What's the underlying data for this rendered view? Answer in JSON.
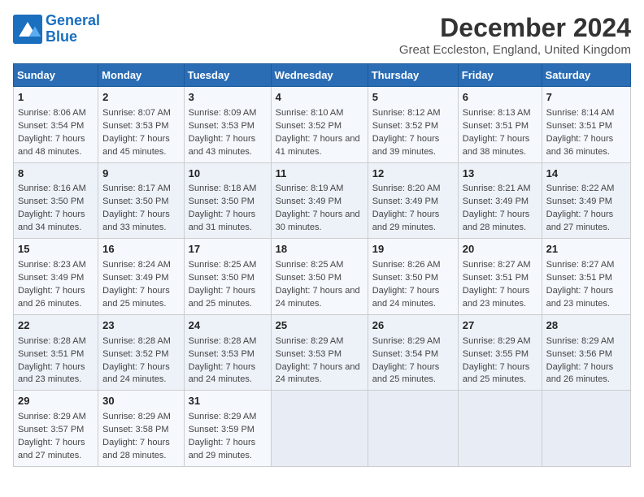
{
  "logo": {
    "line1": "General",
    "line2": "Blue"
  },
  "title": "December 2024",
  "subtitle": "Great Eccleston, England, United Kingdom",
  "days_of_week": [
    "Sunday",
    "Monday",
    "Tuesday",
    "Wednesday",
    "Thursday",
    "Friday",
    "Saturday"
  ],
  "weeks": [
    [
      {
        "day": "1",
        "sunrise": "Sunrise: 8:06 AM",
        "sunset": "Sunset: 3:54 PM",
        "daylight": "Daylight: 7 hours and 48 minutes."
      },
      {
        "day": "2",
        "sunrise": "Sunrise: 8:07 AM",
        "sunset": "Sunset: 3:53 PM",
        "daylight": "Daylight: 7 hours and 45 minutes."
      },
      {
        "day": "3",
        "sunrise": "Sunrise: 8:09 AM",
        "sunset": "Sunset: 3:53 PM",
        "daylight": "Daylight: 7 hours and 43 minutes."
      },
      {
        "day": "4",
        "sunrise": "Sunrise: 8:10 AM",
        "sunset": "Sunset: 3:52 PM",
        "daylight": "Daylight: 7 hours and 41 minutes."
      },
      {
        "day": "5",
        "sunrise": "Sunrise: 8:12 AM",
        "sunset": "Sunset: 3:52 PM",
        "daylight": "Daylight: 7 hours and 39 minutes."
      },
      {
        "day": "6",
        "sunrise": "Sunrise: 8:13 AM",
        "sunset": "Sunset: 3:51 PM",
        "daylight": "Daylight: 7 hours and 38 minutes."
      },
      {
        "day": "7",
        "sunrise": "Sunrise: 8:14 AM",
        "sunset": "Sunset: 3:51 PM",
        "daylight": "Daylight: 7 hours and 36 minutes."
      }
    ],
    [
      {
        "day": "8",
        "sunrise": "Sunrise: 8:16 AM",
        "sunset": "Sunset: 3:50 PM",
        "daylight": "Daylight: 7 hours and 34 minutes."
      },
      {
        "day": "9",
        "sunrise": "Sunrise: 8:17 AM",
        "sunset": "Sunset: 3:50 PM",
        "daylight": "Daylight: 7 hours and 33 minutes."
      },
      {
        "day": "10",
        "sunrise": "Sunrise: 8:18 AM",
        "sunset": "Sunset: 3:50 PM",
        "daylight": "Daylight: 7 hours and 31 minutes."
      },
      {
        "day": "11",
        "sunrise": "Sunrise: 8:19 AM",
        "sunset": "Sunset: 3:49 PM",
        "daylight": "Daylight: 7 hours and 30 minutes."
      },
      {
        "day": "12",
        "sunrise": "Sunrise: 8:20 AM",
        "sunset": "Sunset: 3:49 PM",
        "daylight": "Daylight: 7 hours and 29 minutes."
      },
      {
        "day": "13",
        "sunrise": "Sunrise: 8:21 AM",
        "sunset": "Sunset: 3:49 PM",
        "daylight": "Daylight: 7 hours and 28 minutes."
      },
      {
        "day": "14",
        "sunrise": "Sunrise: 8:22 AM",
        "sunset": "Sunset: 3:49 PM",
        "daylight": "Daylight: 7 hours and 27 minutes."
      }
    ],
    [
      {
        "day": "15",
        "sunrise": "Sunrise: 8:23 AM",
        "sunset": "Sunset: 3:49 PM",
        "daylight": "Daylight: 7 hours and 26 minutes."
      },
      {
        "day": "16",
        "sunrise": "Sunrise: 8:24 AM",
        "sunset": "Sunset: 3:49 PM",
        "daylight": "Daylight: 7 hours and 25 minutes."
      },
      {
        "day": "17",
        "sunrise": "Sunrise: 8:25 AM",
        "sunset": "Sunset: 3:50 PM",
        "daylight": "Daylight: 7 hours and 25 minutes."
      },
      {
        "day": "18",
        "sunrise": "Sunrise: 8:25 AM",
        "sunset": "Sunset: 3:50 PM",
        "daylight": "Daylight: 7 hours and 24 minutes."
      },
      {
        "day": "19",
        "sunrise": "Sunrise: 8:26 AM",
        "sunset": "Sunset: 3:50 PM",
        "daylight": "Daylight: 7 hours and 24 minutes."
      },
      {
        "day": "20",
        "sunrise": "Sunrise: 8:27 AM",
        "sunset": "Sunset: 3:51 PM",
        "daylight": "Daylight: 7 hours and 23 minutes."
      },
      {
        "day": "21",
        "sunrise": "Sunrise: 8:27 AM",
        "sunset": "Sunset: 3:51 PM",
        "daylight": "Daylight: 7 hours and 23 minutes."
      }
    ],
    [
      {
        "day": "22",
        "sunrise": "Sunrise: 8:28 AM",
        "sunset": "Sunset: 3:51 PM",
        "daylight": "Daylight: 7 hours and 23 minutes."
      },
      {
        "day": "23",
        "sunrise": "Sunrise: 8:28 AM",
        "sunset": "Sunset: 3:52 PM",
        "daylight": "Daylight: 7 hours and 24 minutes."
      },
      {
        "day": "24",
        "sunrise": "Sunrise: 8:28 AM",
        "sunset": "Sunset: 3:53 PM",
        "daylight": "Daylight: 7 hours and 24 minutes."
      },
      {
        "day": "25",
        "sunrise": "Sunrise: 8:29 AM",
        "sunset": "Sunset: 3:53 PM",
        "daylight": "Daylight: 7 hours and 24 minutes."
      },
      {
        "day": "26",
        "sunrise": "Sunrise: 8:29 AM",
        "sunset": "Sunset: 3:54 PM",
        "daylight": "Daylight: 7 hours and 25 minutes."
      },
      {
        "day": "27",
        "sunrise": "Sunrise: 8:29 AM",
        "sunset": "Sunset: 3:55 PM",
        "daylight": "Daylight: 7 hours and 25 minutes."
      },
      {
        "day": "28",
        "sunrise": "Sunrise: 8:29 AM",
        "sunset": "Sunset: 3:56 PM",
        "daylight": "Daylight: 7 hours and 26 minutes."
      }
    ],
    [
      {
        "day": "29",
        "sunrise": "Sunrise: 8:29 AM",
        "sunset": "Sunset: 3:57 PM",
        "daylight": "Daylight: 7 hours and 27 minutes."
      },
      {
        "day": "30",
        "sunrise": "Sunrise: 8:29 AM",
        "sunset": "Sunset: 3:58 PM",
        "daylight": "Daylight: 7 hours and 28 minutes."
      },
      {
        "day": "31",
        "sunrise": "Sunrise: 8:29 AM",
        "sunset": "Sunset: 3:59 PM",
        "daylight": "Daylight: 7 hours and 29 minutes."
      },
      null,
      null,
      null,
      null
    ]
  ]
}
